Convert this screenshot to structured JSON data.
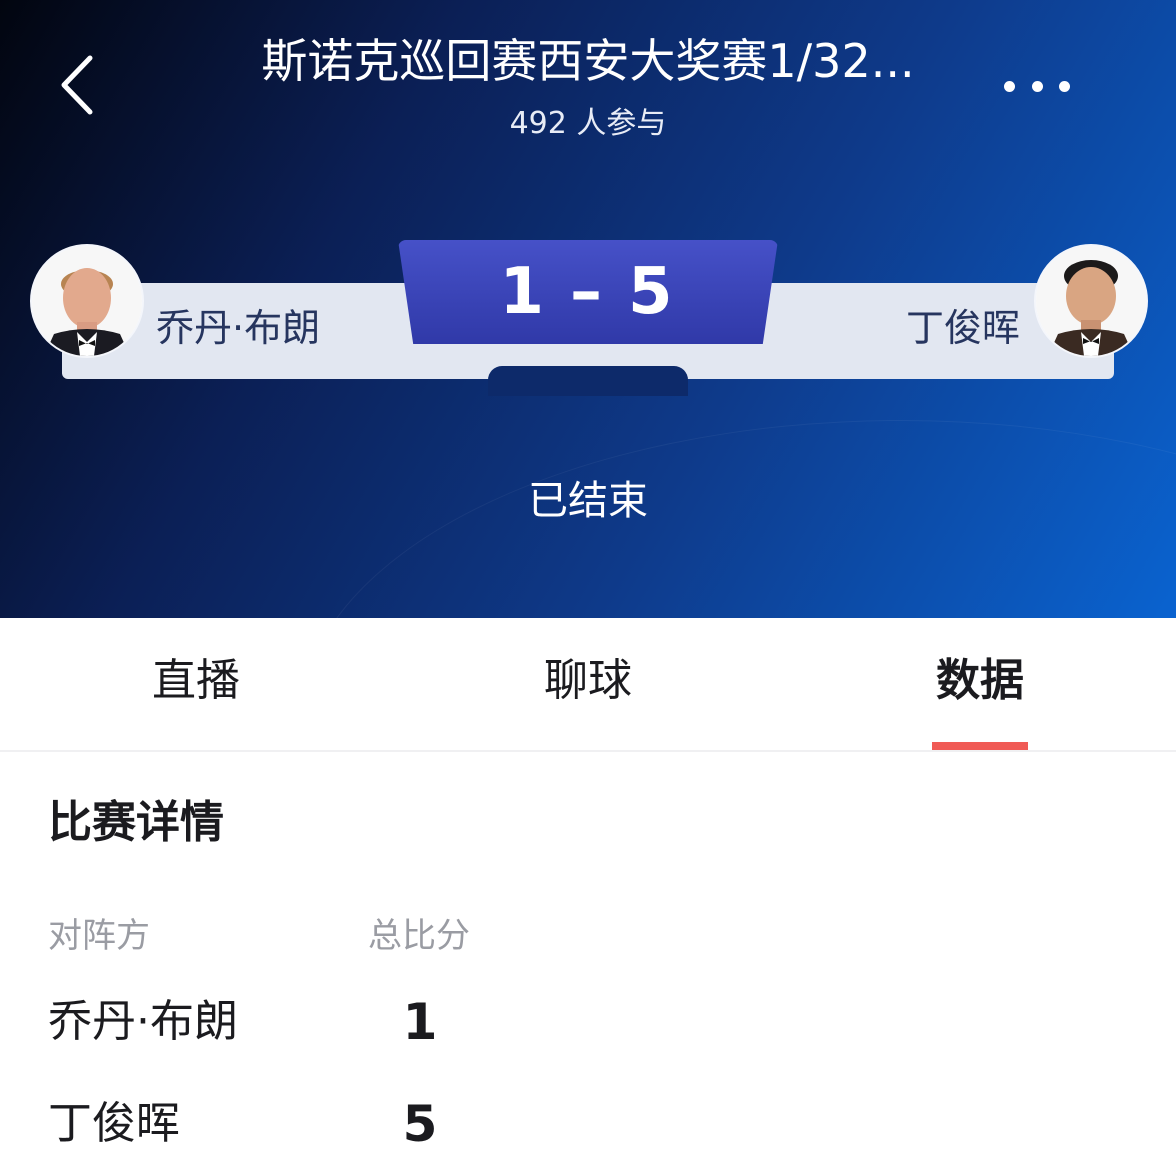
{
  "header": {
    "title": "斯诺克巡回赛西安大奖赛1/32...",
    "participants": "492 人参与",
    "back_icon": "chevron-left-icon",
    "more_icon": "ellipsis-icon"
  },
  "match": {
    "home": {
      "name": "乔丹·布朗",
      "score": "1"
    },
    "away": {
      "name": "丁俊晖",
      "score": "5"
    },
    "dash": "–",
    "status": "已结束"
  },
  "tabs": [
    {
      "label": "直播"
    },
    {
      "label": "聊球"
    },
    {
      "label": "数据"
    }
  ],
  "details": {
    "title": "比赛详情",
    "columns": [
      "对阵方",
      "总比分"
    ],
    "rows": [
      {
        "name": "乔丹·布朗",
        "score": "1"
      },
      {
        "name": "丁俊晖",
        "score": "5"
      }
    ]
  },
  "colors": {
    "score_box": "#3a43b6",
    "tab_indicator": "#f05a55"
  }
}
